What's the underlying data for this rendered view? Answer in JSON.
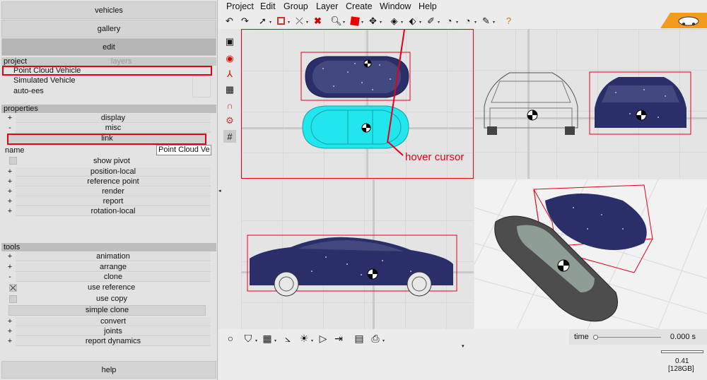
{
  "left": {
    "buttons": {
      "vehicles": "vehicles",
      "gallery": "gallery",
      "edit": "edit",
      "help": "help"
    },
    "project": {
      "tab_project": "project",
      "tab_layers": "layers",
      "items": [
        "Point Cloud Vehicle",
        "Simulated Vehicle",
        "auto-ees"
      ]
    },
    "properties": {
      "header": "properties",
      "display": "display",
      "misc": "misc",
      "link": "link",
      "name_label": "name",
      "name_value": "Point Cloud Ve",
      "show_pivot": "show pivot",
      "position_local": "position-local",
      "reference_point": "reference point",
      "render": "render",
      "report": "report",
      "rotation_local": "rotation-local"
    },
    "tools": {
      "header": "tools",
      "animation": "animation",
      "arrange": "arrange",
      "clone": "clone",
      "use_reference": "use reference",
      "use_copy": "use copy",
      "simple_clone": "simple clone",
      "convert": "convert",
      "joints": "joints",
      "report_dynamics": "report dynamics"
    },
    "plus": "+",
    "minus": "-"
  },
  "menu": [
    "Project",
    "Edit",
    "Group",
    "Layer",
    "Create",
    "Window",
    "Help"
  ],
  "annotation": {
    "hover_cursor": "hover cursor"
  },
  "status": {
    "time_label": "time",
    "time_value": "0.000 s",
    "memory_value": "0.41",
    "memory_total": "[128GB]",
    "time_slider_position": 0.0
  },
  "colors": {
    "highlight_red": "#e3001b",
    "selected_car": "#22e6ee",
    "point_cloud": "#2a2f6a",
    "logo_orange": "#f39b1f"
  },
  "icons": {
    "toolbar": [
      "undo-icon",
      "redo-icon",
      "select-icon",
      "box-select-icon",
      "deselect-icon",
      "delete-icon",
      "zoom-icon",
      "solid-cube-icon",
      "move-icon",
      "rotate-icon",
      "eraser-icon",
      "paint-icon",
      "measure-icon",
      "scale-icon",
      "pencil-icon",
      "help-icon"
    ],
    "vertical": [
      "camera-icon",
      "record-icon",
      "axis-icon",
      "frame-icon",
      "magnet-icon",
      "gear-settings-icon",
      "grid-icon"
    ],
    "bottom": [
      "sphere-icon",
      "shield-icon",
      "layout-icon",
      "graph-icon",
      "light-icon",
      "play-icon",
      "step-icon",
      "document-icon",
      "print-icon"
    ]
  }
}
